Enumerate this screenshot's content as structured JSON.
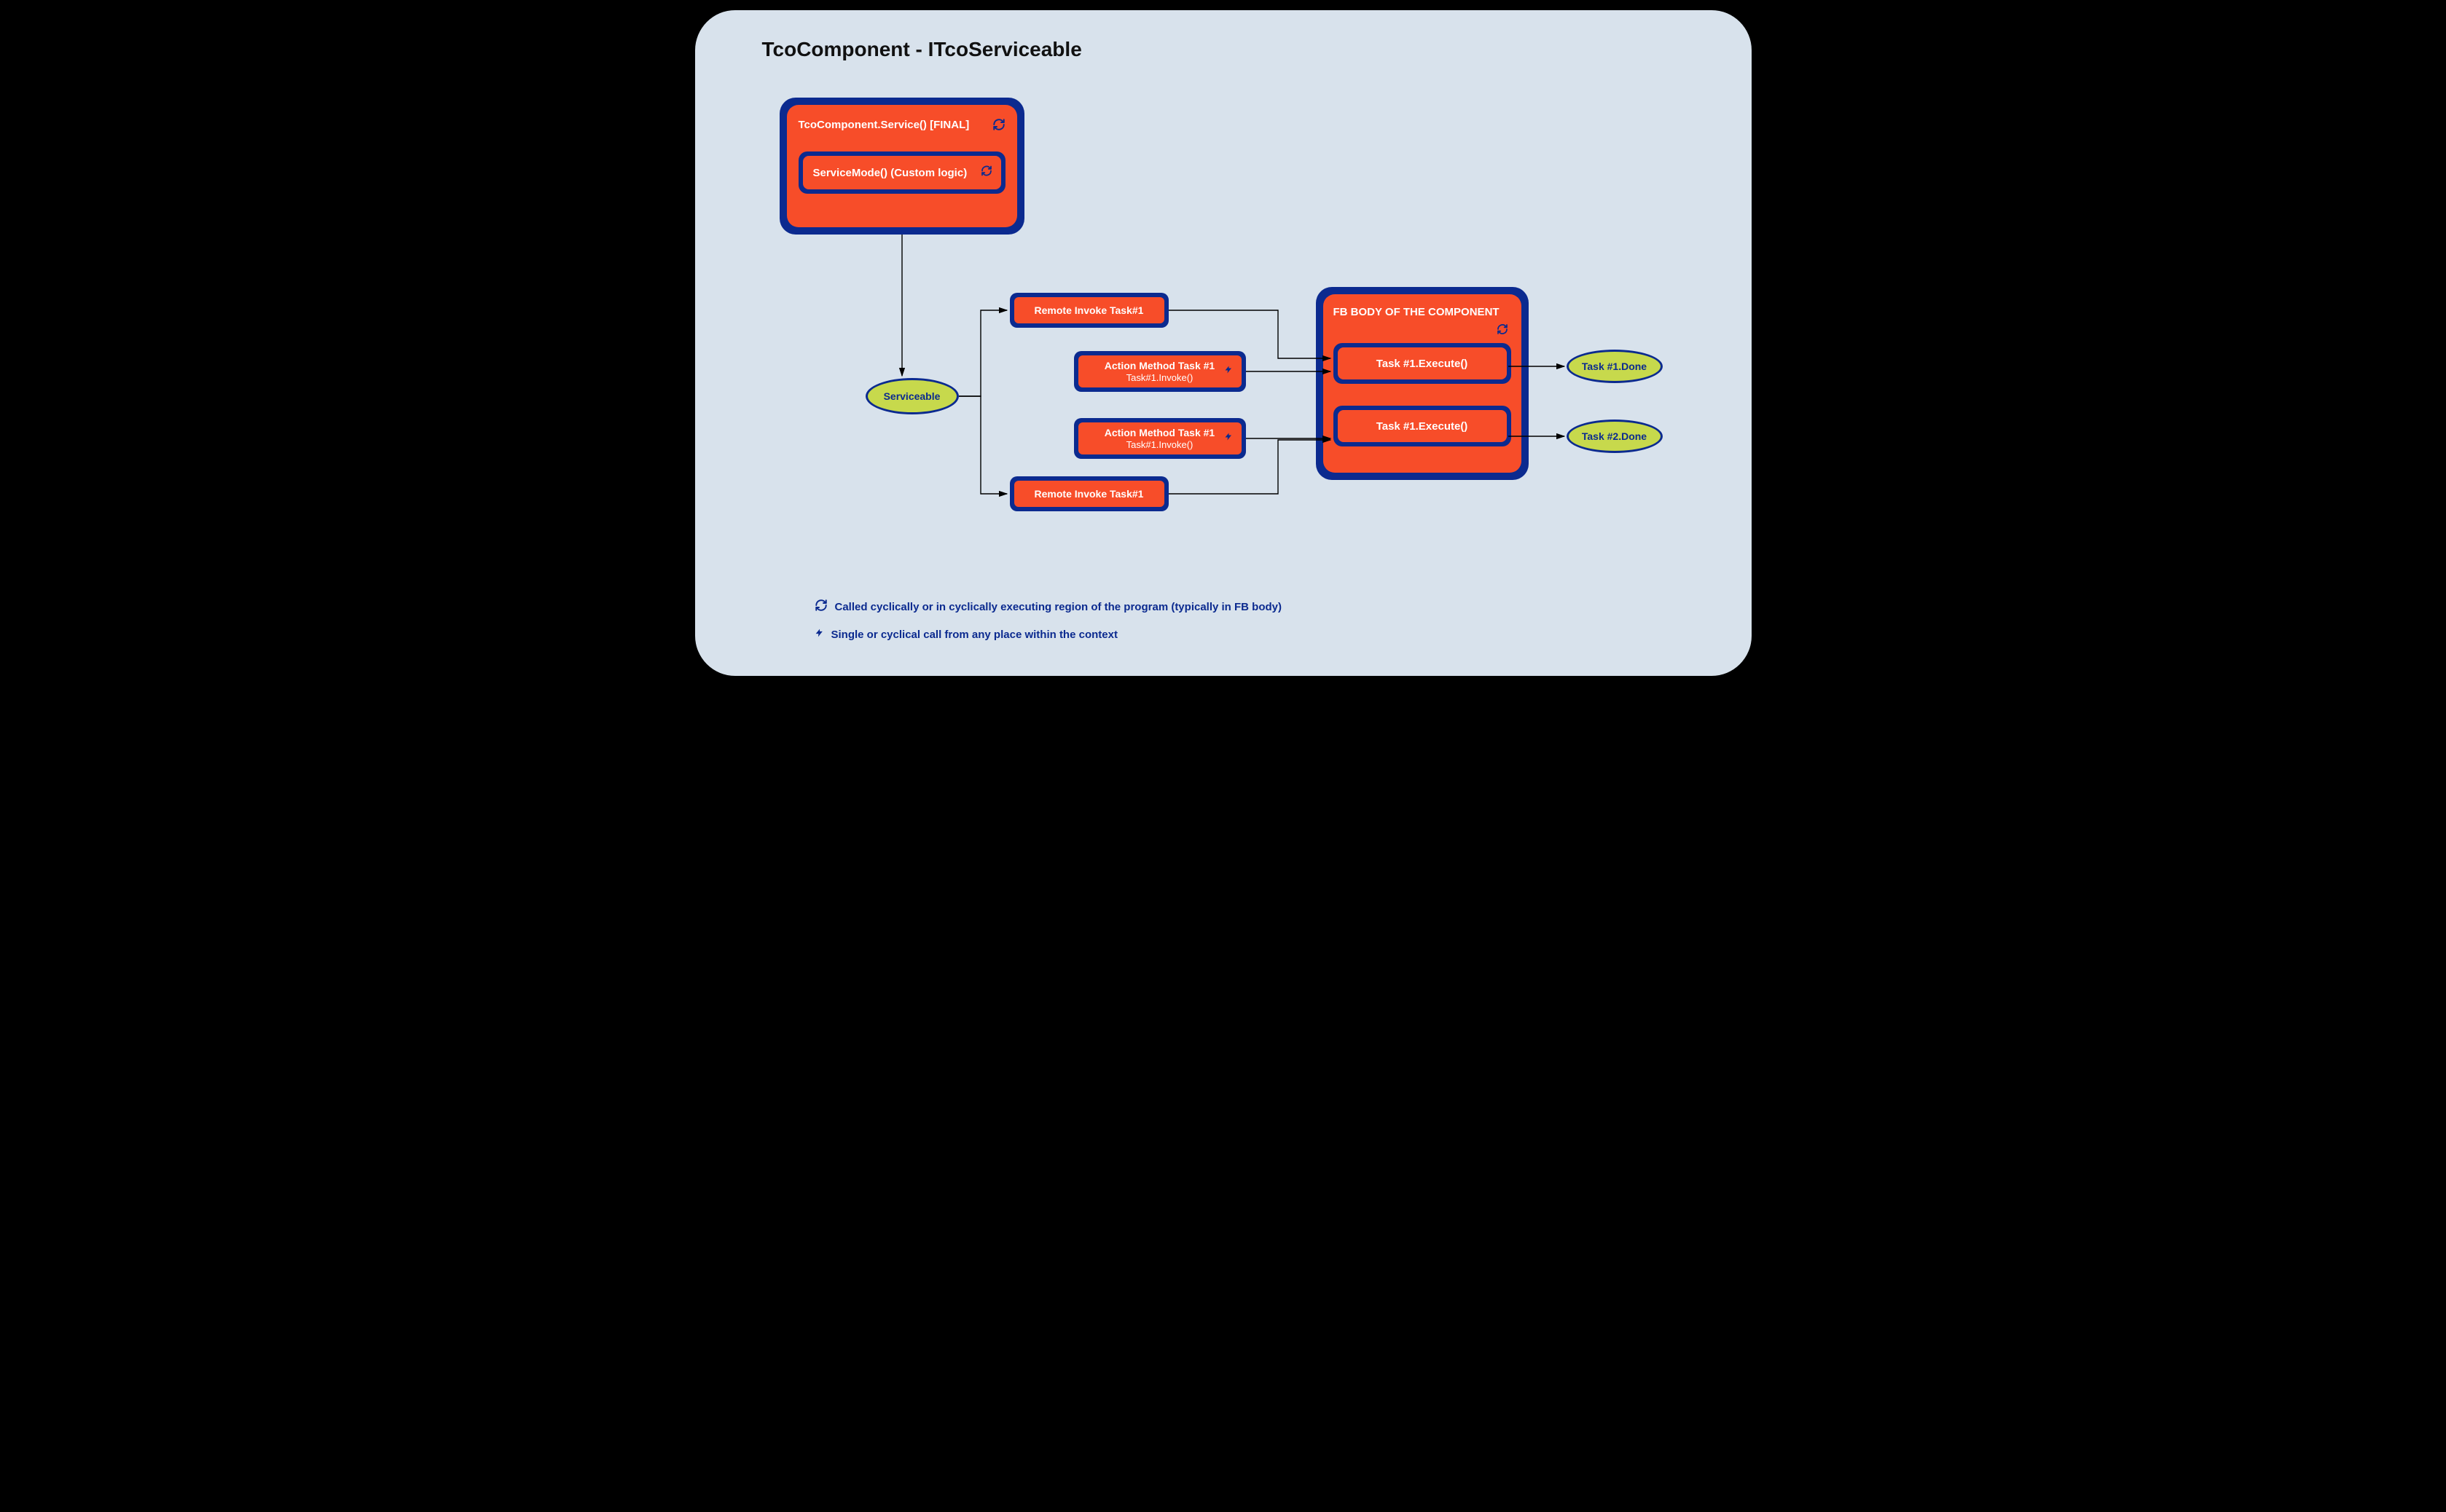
{
  "title": "TcoComponent - ITcoServiceable",
  "serviceBlock": {
    "header": "TcoComponent.Service() [FINAL]",
    "sub": "ServiceMode() (Custom logic)"
  },
  "serviceableOval": "Serviceable",
  "remoteInvoke1": "Remote Invoke Task#1",
  "actionMethod1": {
    "line1": "Action Method Task #1",
    "line2": "Task#1.Invoke()"
  },
  "actionMethod2": {
    "line1": "Action Method Task #1",
    "line2": "Task#1.Invoke()"
  },
  "remoteInvoke2": "Remote Invoke Task#1",
  "fbBody": {
    "header": "FB BODY OF THE COMPONENT",
    "task1": "Task #1.Execute()",
    "task2": "Task #1.Execute()"
  },
  "done1": "Task #1.Done",
  "done2": "Task #2.Done",
  "legend": {
    "cyclic": "Called cyclically or in cyclically executing region of the program (typically in FB body)",
    "single": "Single or cyclical call from any place within the context"
  },
  "colors": {
    "panel": "#d8e2ec",
    "blue": "#0b2a8f",
    "red": "#f74d29",
    "oval": "#c7d94c"
  }
}
